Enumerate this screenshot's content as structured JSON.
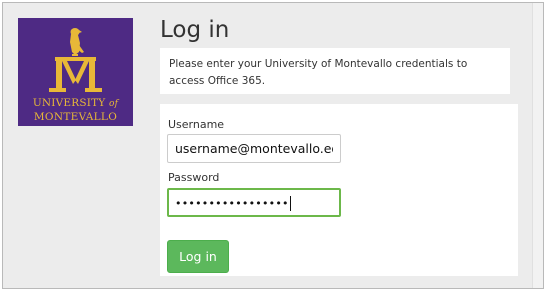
{
  "colors": {
    "brand_purple": "#4e2a84",
    "brand_gold": "#e8b838",
    "focus_green": "#6cb84a",
    "button_green": "#5cb85c"
  },
  "logo": {
    "line1_main": "UNIVERSITY",
    "line1_of": "of",
    "line2": "MONTEVALLO",
    "emblem_icon": "falcon-monogram-icon"
  },
  "page": {
    "title": "Log in",
    "notice": "Please enter your University of Montevallo credentials to access Office 365."
  },
  "form": {
    "username_label": "Username",
    "username_value": "username@montevallo.edu",
    "password_label": "Password",
    "password_masked": "•••••••••••••••••",
    "submit_label": "Log in"
  }
}
